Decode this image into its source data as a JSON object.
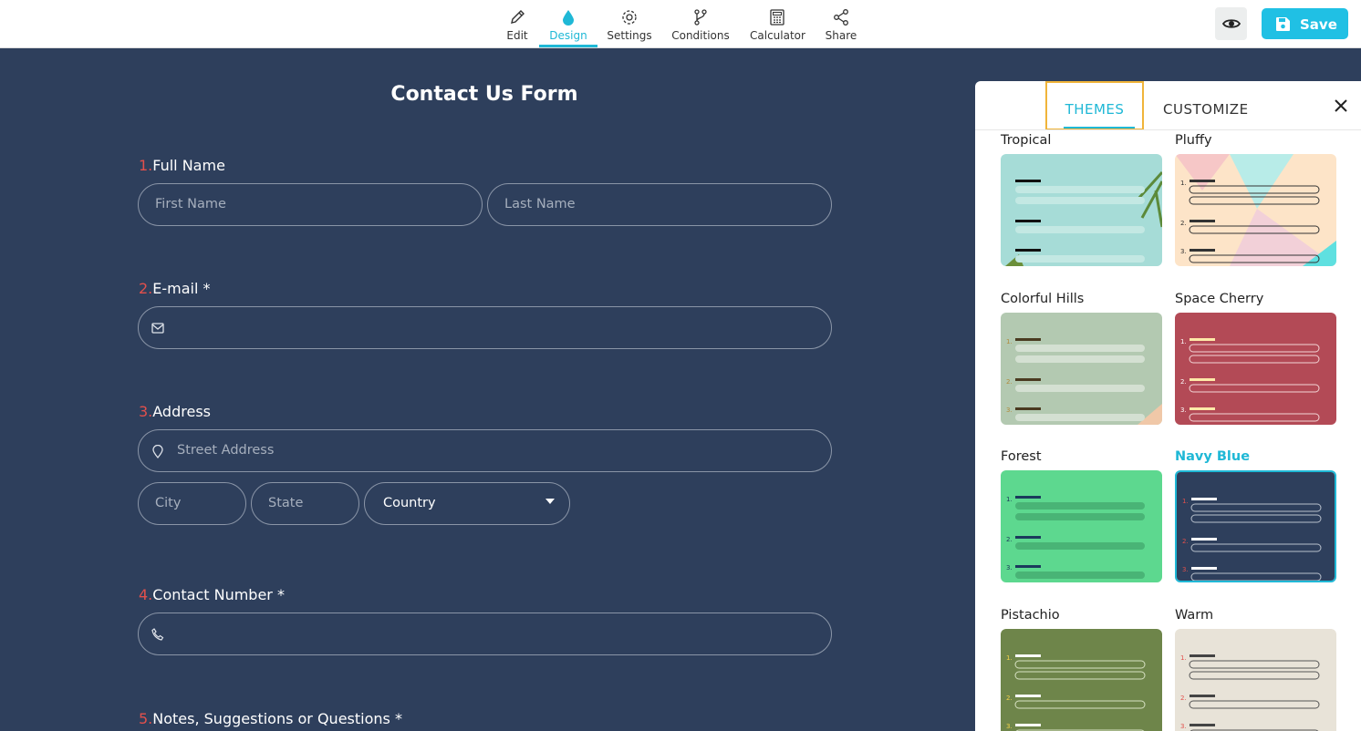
{
  "toolbar": {
    "tabs": [
      {
        "label": "Edit",
        "icon": "pencil-icon"
      },
      {
        "label": "Design",
        "icon": "droplet-icon"
      },
      {
        "label": "Settings",
        "icon": "gear-icon"
      },
      {
        "label": "Conditions",
        "icon": "branch-icon"
      },
      {
        "label": "Calculator",
        "icon": "calculator-icon"
      },
      {
        "label": "Share",
        "icon": "share-icon"
      }
    ],
    "active_tab": "Design",
    "preview_icon": "eye-icon",
    "save_label": "Save"
  },
  "form": {
    "title": "Contact Us Form",
    "questions": [
      {
        "num": "1.",
        "label": "Full Name",
        "required": ""
      },
      {
        "num": "2.",
        "label": "E-mail",
        "required": "*"
      },
      {
        "num": "3.",
        "label": "Address",
        "required": ""
      },
      {
        "num": "4.",
        "label": "Contact Number",
        "required": "*"
      },
      {
        "num": "5.",
        "label": "Notes, Suggestions or Questions",
        "required": "*"
      }
    ],
    "fields": {
      "first_name_placeholder": "First Name",
      "last_name_placeholder": "Last Name",
      "street_placeholder": "Street Address",
      "city_placeholder": "City",
      "state_placeholder": "State",
      "country_value": "Country"
    }
  },
  "panel": {
    "tabs": [
      "THEMES",
      "CUSTOMIZE"
    ],
    "active_tab": "THEMES",
    "themes": [
      {
        "name": "Tropical",
        "selected": false
      },
      {
        "name": "Pluffy",
        "selected": false
      },
      {
        "name": "Colorful Hills",
        "selected": false
      },
      {
        "name": "Space Cherry",
        "selected": false
      },
      {
        "name": "Forest",
        "selected": false
      },
      {
        "name": "Navy Blue",
        "selected": true
      },
      {
        "name": "Pistachio",
        "selected": false
      },
      {
        "name": "Warm",
        "selected": false
      }
    ],
    "thumb_numbers": [
      "1.",
      "2.",
      "3."
    ]
  },
  "colors": {
    "accent": "#1fb8d6",
    "canvas": "#2e3f5c",
    "question_number": "#e2504c",
    "highlight_box": "#f0b43a"
  }
}
